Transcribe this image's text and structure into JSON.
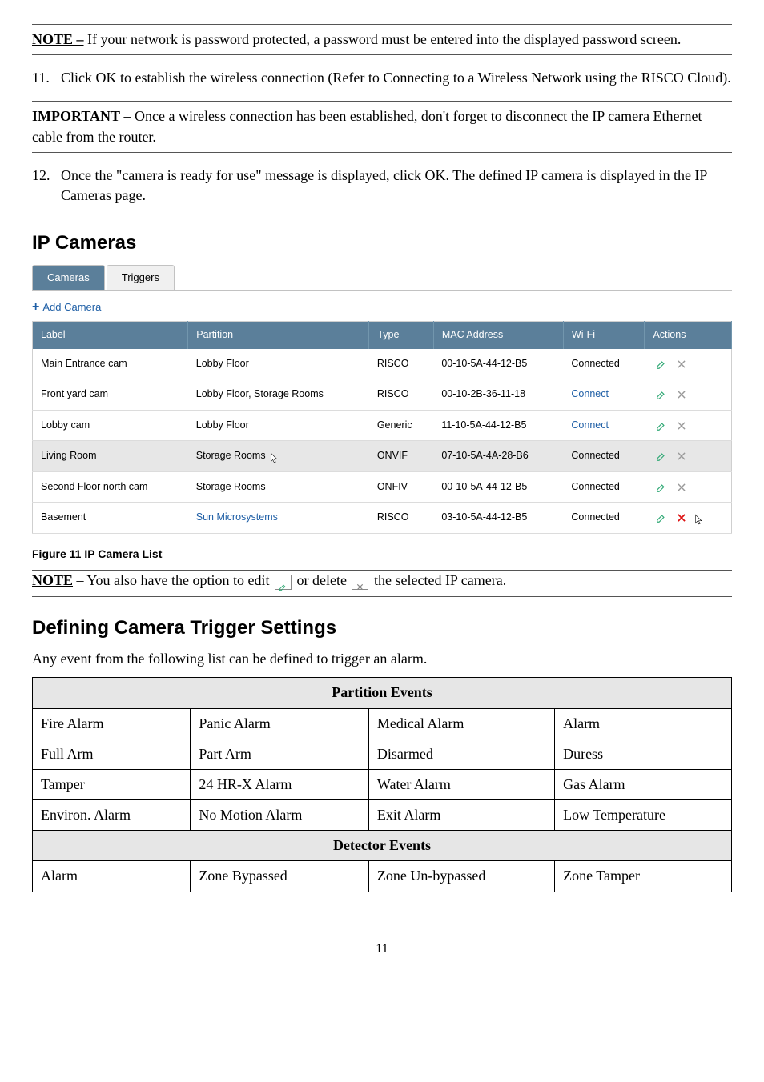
{
  "note1": {
    "label": "NOTE –",
    "text": " If your network is password protected, a password must be entered into the displayed password screen."
  },
  "step11": {
    "num": "11.",
    "text": "Click OK to establish the wireless connection (Refer to Connecting to a Wireless Network using the RISCO Cloud)."
  },
  "important": {
    "label": "IMPORTANT",
    "text": " – Once a wireless connection has been established, don't forget to disconnect the IP camera Ethernet cable from the router."
  },
  "step12": {
    "num": "12.",
    "text": "Once the \"camera is ready for use\" message is displayed, click OK. The defined IP camera is displayed in the IP Cameras page."
  },
  "ip_cameras_title": "IP Cameras",
  "tabs": {
    "cameras": "Cameras",
    "triggers": "Triggers"
  },
  "add_camera": "Add Camera",
  "table": {
    "headers": {
      "label": "Label",
      "partition": "Partition",
      "type": "Type",
      "mac": "MAC Address",
      "wifi": "Wi-Fi",
      "actions": "Actions"
    },
    "rows": [
      {
        "label": "Main Entrance cam",
        "partition": "Lobby Floor",
        "type": "RISCO",
        "mac": "00-10-5A-44-12-B5",
        "wifi": "Connected",
        "wifi_link": false
      },
      {
        "label": "Front yard cam",
        "partition": "Lobby Floor, Storage Rooms",
        "type": "RISCO",
        "mac": "00-10-2B-36-11-18",
        "wifi": "Connect",
        "wifi_link": true
      },
      {
        "label": "Lobby cam",
        "partition": "Lobby Floor",
        "type": "Generic",
        "mac": "11-10-5A-44-12-B5",
        "wifi": "Connect",
        "wifi_link": true
      },
      {
        "label": "Living Room",
        "partition": "Storage Rooms",
        "type": "ONVIF",
        "mac": "07-10-5A-4A-28-B6",
        "wifi": "Connected",
        "wifi_link": false,
        "shaded": true,
        "cursor": true
      },
      {
        "label": "Second Floor north cam",
        "partition": "Storage Rooms",
        "type": "ONFIV",
        "mac": "00-10-5A-44-12-B5",
        "wifi": "Connected",
        "wifi_link": false
      },
      {
        "label": "Basement",
        "partition": "Sun Microsystems",
        "partition_blue": true,
        "type": "RISCO",
        "mac": "03-10-5A-44-12-B5",
        "wifi": "Connected",
        "wifi_link": false,
        "del_red": true,
        "cursor_del": true
      }
    ]
  },
  "figure_caption": "Figure 11 IP Camera List",
  "note2": {
    "label": "NOTE",
    "part1": " – You also have the option to edit ",
    "part2": " or delete ",
    "part3": " the selected IP camera."
  },
  "section_title": "Defining Camera Trigger Settings",
  "section_desc": "Any event from the following list can be defined to trigger an alarm.",
  "events": {
    "partition_header": "Partition Events",
    "partition_rows": [
      [
        "Fire Alarm",
        "Panic Alarm",
        "Medical Alarm",
        "Alarm"
      ],
      [
        "Full Arm",
        "Part Arm",
        "Disarmed",
        "Duress"
      ],
      [
        "Tamper",
        "24 HR-X Alarm",
        "Water Alarm",
        "Gas Alarm"
      ],
      [
        "Environ. Alarm",
        "No Motion Alarm",
        "Exit Alarm",
        "Low Temperature"
      ]
    ],
    "detector_header": "Detector Events",
    "detector_rows": [
      [
        "Alarm",
        "Zone Bypassed",
        "Zone Un-bypassed",
        "Zone Tamper"
      ]
    ]
  },
  "page_number": "11"
}
